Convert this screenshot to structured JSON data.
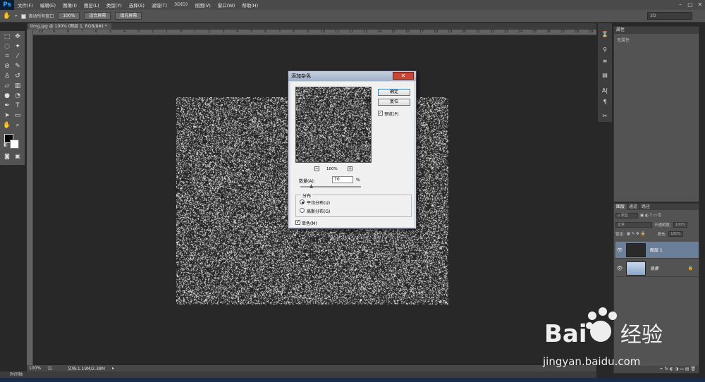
{
  "app": {
    "logo": "Ps"
  },
  "menu": [
    "文件(F)",
    "编辑(E)",
    "图像(I)",
    "图层(L)",
    "类型(Y)",
    "选择(S)",
    "滤镜(T)",
    "3D(D)",
    "视图(V)",
    "窗口(W)",
    "帮助(H)"
  ],
  "window_buttons": [
    "–",
    "□",
    "✕"
  ],
  "options": {
    "scroll_all_label": "滚动所有窗口",
    "zoom_100": "100%",
    "fit_screen": "适合屏幕",
    "fill_screen": "填充屏幕",
    "workspace": "3D"
  },
  "document": {
    "tab_title": "timg.jpg @ 100% (图层 1, RGB/8#) *",
    "close": "×"
  },
  "ruler_marks": [
    "10",
    "9",
    "8",
    "7",
    "6",
    "5",
    "4",
    "3",
    "2",
    "1",
    "0",
    "1",
    "2",
    "3",
    "4",
    "5",
    "6",
    "7",
    "8",
    "9",
    "10",
    "11",
    "12",
    "13",
    "14",
    "15",
    "16",
    "17",
    "18",
    "19",
    "20",
    "21",
    "22",
    "23",
    "24",
    "25",
    "26",
    "27",
    "28",
    "29"
  ],
  "status": {
    "zoom": "100%",
    "doc_info": "文档:1.19M/2.38M"
  },
  "timeline_label": "时间轴",
  "properties": {
    "tab": "属性",
    "text": "无属性"
  },
  "layers_panel": {
    "tabs": [
      "图层",
      "通道",
      "路径"
    ],
    "filter_label": "ρ 类型",
    "blend_mode": "正常",
    "opacity_label": "不透明度:",
    "opacity_value": "100%",
    "lock_label": "锁定:",
    "fill_label": "填充:",
    "fill_value": "100%",
    "layers": [
      {
        "name": "图层 1",
        "selected": true
      },
      {
        "name": "背景",
        "selected": false,
        "locked": true
      }
    ]
  },
  "dialog": {
    "title": "添加杂色",
    "close": "✕",
    "ok": "确定",
    "reset": "复位",
    "preview_label": "预览(P)",
    "zoom_level": "100%",
    "zoom_out": "−",
    "zoom_in": "+",
    "amount_label": "数量(A):",
    "amount_value": "70",
    "amount_unit": "%",
    "amount_fraction": 0.175,
    "distribution_label": "分布",
    "uniform_label": "平均分布(U)",
    "gaussian_label": "高斯分布(G)",
    "monochromatic_label": "单色(M)",
    "check": "✓"
  },
  "watermark": {
    "brand": "Bai du",
    "site": "jingyan.baidu.com",
    "cn": "经验"
  }
}
